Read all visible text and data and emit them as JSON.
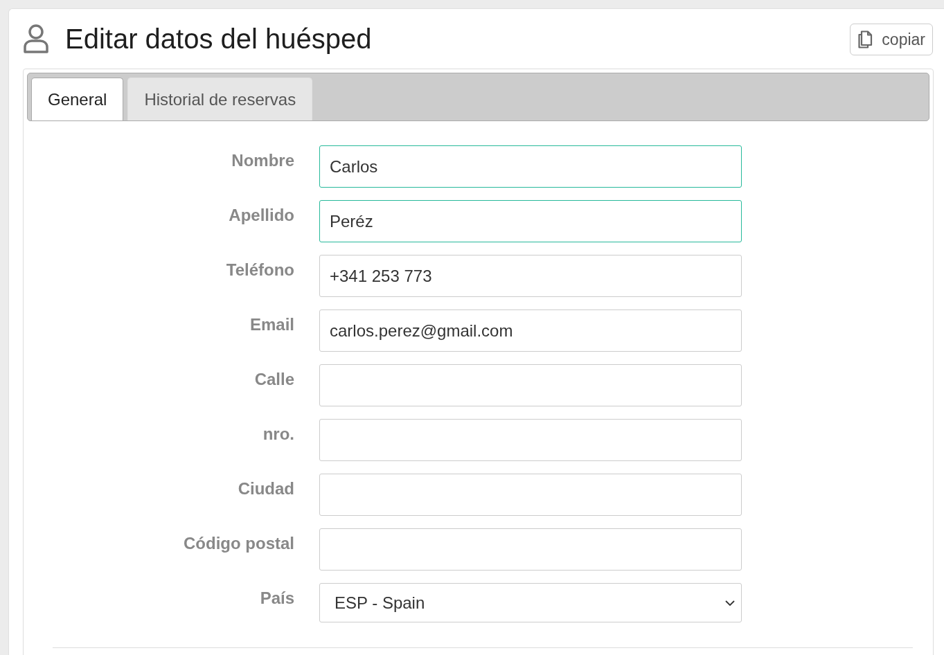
{
  "header": {
    "title": "Editar datos del huésped",
    "copy_button": {
      "label": "copiar"
    }
  },
  "tabs": [
    {
      "label": "General",
      "selected": true
    },
    {
      "label": "Historial de reservas",
      "selected": false
    }
  ],
  "form": {
    "fields": [
      {
        "kind": "text",
        "label": "Nombre",
        "value": "Carlos",
        "valid": true
      },
      {
        "kind": "text",
        "label": "Apellido",
        "value": "Peréz",
        "valid": true
      },
      {
        "kind": "text",
        "label": "Teléfono",
        "value": "+341 253 773",
        "valid": false
      },
      {
        "kind": "text",
        "label": "Email",
        "value": "carlos.perez@gmail.com",
        "valid": false
      },
      {
        "kind": "text",
        "label": "Calle",
        "valid": false
      },
      {
        "kind": "text",
        "label": "nro.",
        "valid": false
      },
      {
        "kind": "text",
        "label": "Ciudad",
        "valid": false
      },
      {
        "kind": "text",
        "label": "Código postal",
        "valid": false
      },
      {
        "kind": "select",
        "label": "País",
        "value": "ESP - Spain",
        "valid": false
      }
    ]
  }
}
